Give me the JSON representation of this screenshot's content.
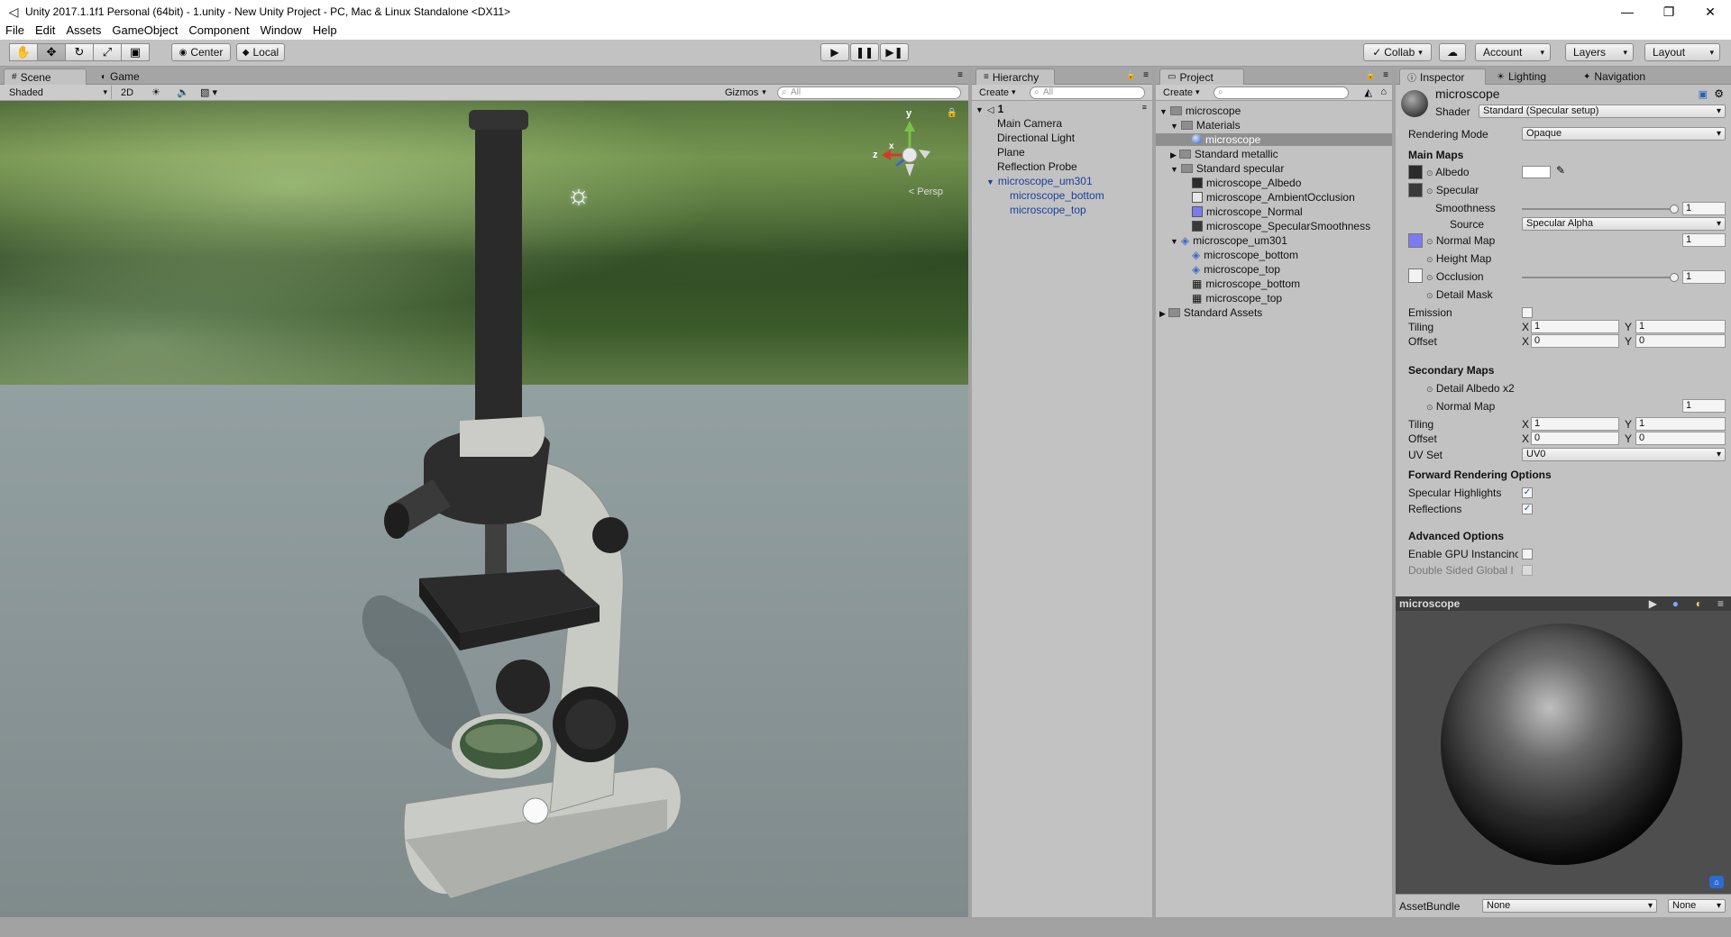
{
  "window": {
    "title": "Unity 2017.1.1f1 Personal (64bit) - 1.unity - New Unity Project - PC, Mac & Linux Standalone <DX11>"
  },
  "menu": [
    "File",
    "Edit",
    "Assets",
    "GameObject",
    "Component",
    "Window",
    "Help"
  ],
  "toolbar": {
    "pivot": "Center",
    "space": "Local",
    "collab": "Collab",
    "account": "Account",
    "layers": "Layers",
    "layout": "Layout"
  },
  "scene": {
    "tabs": [
      "Scene",
      "Game"
    ],
    "shading": "Shaded",
    "mode_2d": "2D",
    "gizmos": "Gizmos",
    "search_placeholder": "All",
    "persp": "< Persp",
    "axis_y": "y",
    "axis_z": "z",
    "axis_x": "x"
  },
  "hierarchy": {
    "tab": "Hierarchy",
    "create": "Create",
    "search_placeholder": "All",
    "scene_name": "1",
    "items": [
      "Main Camera",
      "Directional Light",
      "Plane",
      "Reflection Probe",
      "microscope_um301",
      "microscope_bottom",
      "microscope_top"
    ]
  },
  "project": {
    "tab": "Project",
    "create": "Create",
    "items": [
      "microscope",
      "Materials",
      "microscope",
      "Standard metallic",
      "Standard specular",
      "microscope_Albedo",
      "microscope_AmbientOcclusion",
      "microscope_Normal",
      "microscope_SpecularSmoothness",
      "microscope_um301",
      "microscope_bottom",
      "microscope_top",
      "microscope_bottom",
      "microscope_top",
      "Standard Assets"
    ]
  },
  "inspector": {
    "tabs": [
      "Inspector",
      "Lighting",
      "Navigation"
    ],
    "material_name": "microscope",
    "shader_label": "Shader",
    "shader_value": "Standard (Specular setup)",
    "rendering_mode_label": "Rendering Mode",
    "rendering_mode_value": "Opaque",
    "main_maps": "Main Maps",
    "albedo": "Albedo",
    "specular": "Specular",
    "smoothness": "Smoothness",
    "smoothness_value": "1",
    "source": "Source",
    "source_value": "Specular Alpha",
    "normal_map": "Normal Map",
    "normal_value": "1",
    "height_map": "Height Map",
    "occlusion": "Occlusion",
    "occlusion_value": "1",
    "detail_mask": "Detail Mask",
    "emission": "Emission",
    "tiling": "Tiling",
    "offset": "Offset",
    "x": "X",
    "y": "Y",
    "tiling_x": "1",
    "tiling_y": "1",
    "offset_x": "0",
    "offset_y": "0",
    "secondary_maps": "Secondary Maps",
    "detail_albedo": "Detail Albedo x2",
    "normal_map2": "Normal Map",
    "normal2_value": "1",
    "tiling2": "Tiling",
    "offset2": "Offset",
    "tiling2_x": "1",
    "tiling2_y": "1",
    "offset2_x": "0",
    "offset2_y": "0",
    "uv_set": "UV Set",
    "uv_set_value": "UV0",
    "forward_options": "Forward Rendering Options",
    "specular_highlights": "Specular Highlights",
    "reflections": "Reflections",
    "advanced_options": "Advanced Options",
    "gpu_instancing": "Enable GPU Instancinc",
    "double_sided": "Double Sided Global I",
    "preview_title": "microscope",
    "assetbundle_label": "AssetBundle",
    "assetbundle_value": "None",
    "assetbundle_variant": "None"
  }
}
